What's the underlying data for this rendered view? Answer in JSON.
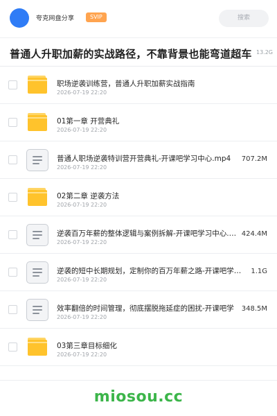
{
  "header": {
    "user_name": "夸克网盘分享",
    "badge": "SVIP",
    "search_placeholder": "搜索"
  },
  "share": {
    "title": "普通人升职加薪的实战路径，不靠背景也能弯道超车",
    "size": "13.2G"
  },
  "files": [
    {
      "type": "folder",
      "name": "职场逆袭训练营，普通人升职加薪实战指南",
      "date": "2026-07-19 22:20",
      "size": ""
    },
    {
      "type": "folder",
      "name": "01第一章 开营典礼",
      "date": "2026-07-19 22:20",
      "size": ""
    },
    {
      "type": "file",
      "name": "普通人职场逆袭特训营开营典礼-开课吧学习中心.mp4",
      "date": "2026-07-19 22:20",
      "size": "707.2M"
    },
    {
      "type": "folder",
      "name": "02第二章 逆袭方法",
      "date": "2026-07-19 22:20",
      "size": ""
    },
    {
      "type": "file",
      "name": "逆袭百万年薪的整体逻辑与案例拆解-开课吧学习中心.…",
      "date": "2026-07-19 22:20",
      "size": "424.4M"
    },
    {
      "type": "file",
      "name": "逆袭的短中长期规划，定制你的百万年薪之路-开课吧学…",
      "date": "2026-07-19 22:20",
      "size": "1.1G"
    },
    {
      "type": "file",
      "name": "效率翻倍的时间管理，彻底摆脱拖延症的困扰-开课吧学",
      "date": "2026-07-19 22:20",
      "size": "348.5M"
    },
    {
      "type": "folder",
      "name": "03第三章目标细化",
      "date": "2026-07-19 22:20",
      "size": ""
    }
  ],
  "icons": {
    "folder": "folder-icon",
    "file": "document-icon"
  },
  "watermark": "miosou.cc",
  "colors": {
    "avatar": "#2f7cf6",
    "svip": "#ffa44f",
    "folder": "#ffc32c",
    "watermark": "#3cb54a"
  }
}
